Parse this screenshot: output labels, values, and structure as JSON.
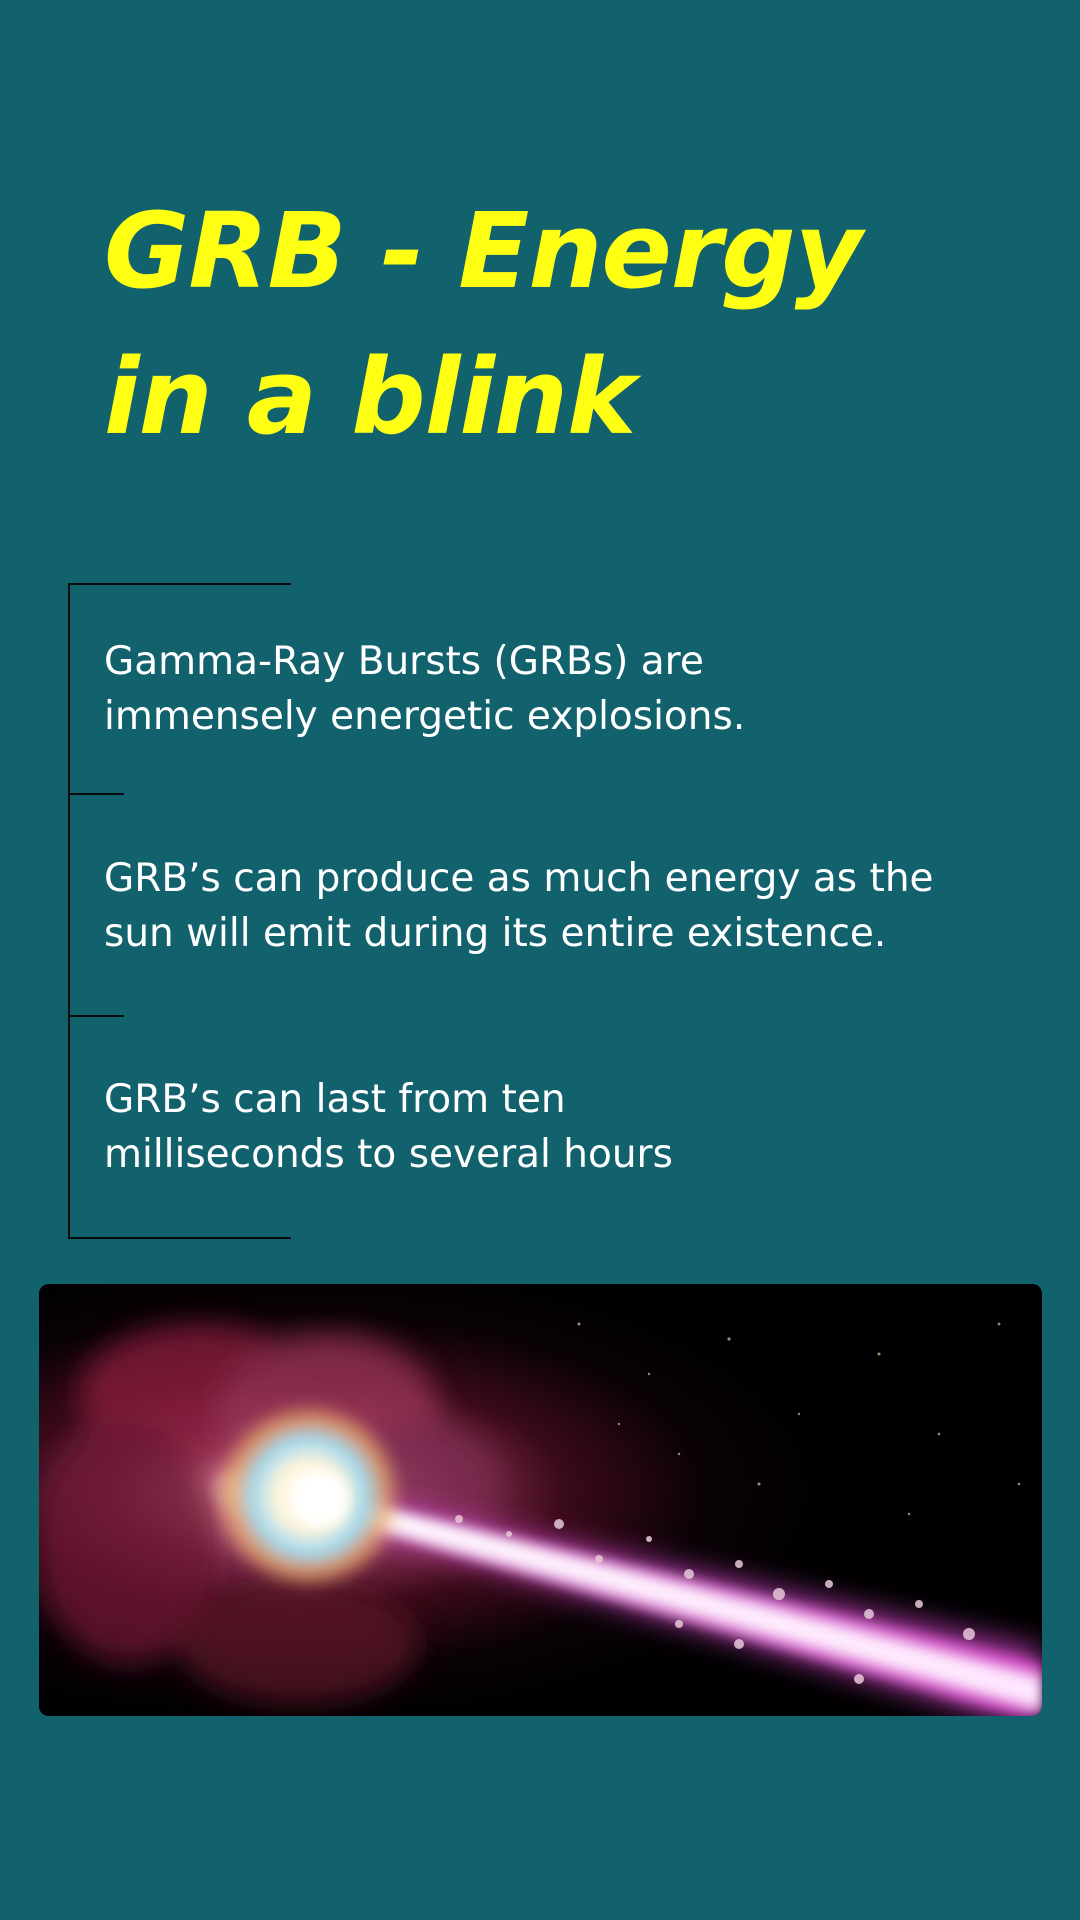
{
  "title": {
    "line1": "GRB - Energy",
    "line2": "in a blink"
  },
  "points": [
    {
      "line1": "Gamma-Ray Bursts (GRBs) are",
      "line2": "immensely energetic explosions."
    },
    {
      "line1": "GRB’s can produce as much energy as the",
      "line2": "sun will emit during its entire existence."
    },
    {
      "line1": "GRB’s can last from ten",
      "line2": "milliseconds to several hours"
    }
  ],
  "image": {
    "subject": "gamma-ray burst jet illustration"
  },
  "colors": {
    "background": "#12626e",
    "title": "#ffff14",
    "text": "#ffffff",
    "timeline": "#0b0b0b"
  }
}
